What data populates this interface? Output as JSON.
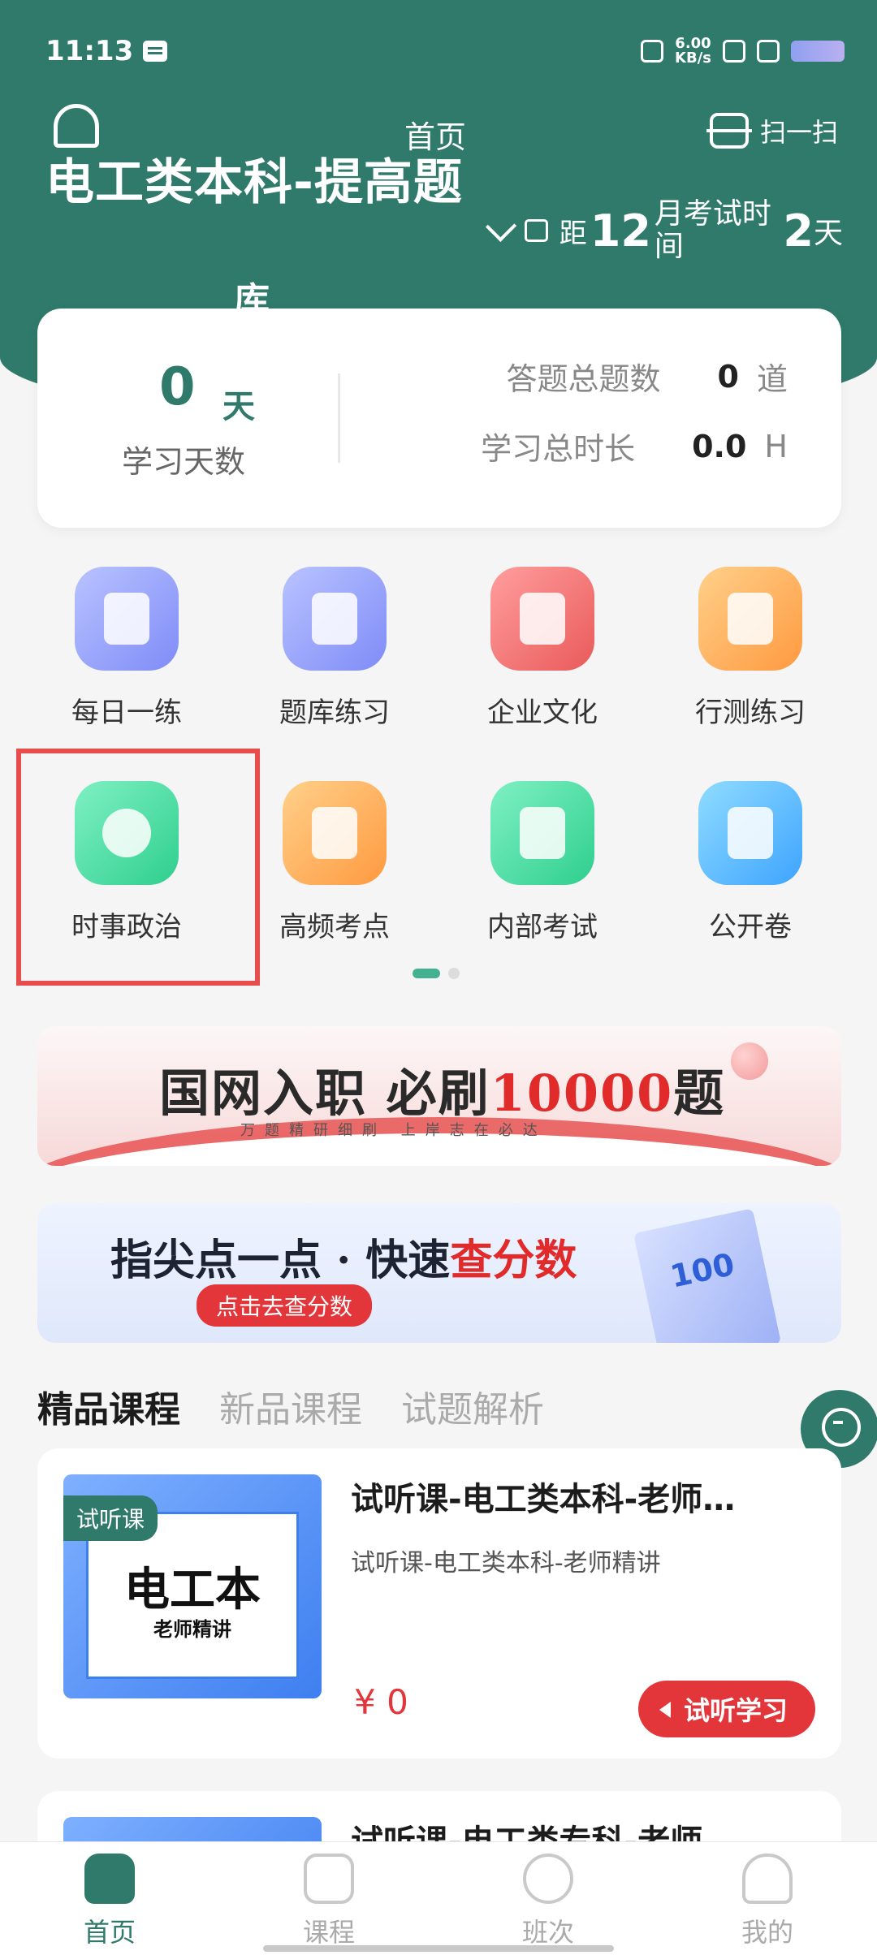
{
  "status_bar": {
    "time": "11:13",
    "net_speed": "6.00",
    "net_unit": "KB/s"
  },
  "header": {
    "page_tab": "首页",
    "title": "电工类本科-提高题",
    "title_wrap": "库",
    "scan_label": "扫一扫",
    "exam_distance_prefix": "距",
    "exam_month_num": "12",
    "exam_month_text": "月考试时间",
    "exam_days_num": "2",
    "exam_days_unit": "天"
  },
  "stats": {
    "study_days_value": "0",
    "study_days_unit": "天",
    "study_days_label": "学习天数",
    "total_questions_label": "答题总题数",
    "total_questions_value": "0",
    "total_questions_unit": "道",
    "total_time_label": "学习总时长",
    "total_time_value": "0.0",
    "total_time_unit": "H"
  },
  "menu": [
    {
      "label": "每日一练",
      "icon": "pencil-note-icon",
      "color": "#8f9bfb"
    },
    {
      "label": "题库练习",
      "icon": "calculator-icon",
      "color": "#8f9bfb"
    },
    {
      "label": "企业文化",
      "icon": "book-icon",
      "color": "#ea5a5a"
    },
    {
      "label": "行测练习",
      "icon": "open-book-icon",
      "color": "#ff9a40"
    },
    {
      "label": "时事政治",
      "icon": "globe-icon",
      "color": "#2fcf8e"
    },
    {
      "label": "高频考点",
      "icon": "receipt-icon",
      "color": "#ff9a40"
    },
    {
      "label": "内部考试",
      "icon": "certificate-icon",
      "color": "#2fcf8e"
    },
    {
      "label": "公开卷",
      "icon": "clipboard-list-icon",
      "color": "#3ea4ff"
    }
  ],
  "banners": {
    "b1_main_a": "国网入职 必刷",
    "b1_main_red": "10000",
    "b1_main_b": "题",
    "b1_sub": "万题精研细刷 上岸志在必达",
    "b2_main_a": "指尖点一点 · 快速",
    "b2_main_red": "查分数",
    "b2_button": "点击去查分数",
    "b2_paper": "100"
  },
  "tabs": [
    "精品课程",
    "新品课程",
    "试题解析"
  ],
  "courses": [
    {
      "tag": "试听课",
      "thumb_title": "电工本",
      "thumb_sub": "老师精讲",
      "title": "试听课-电工类本科-老师…",
      "subtitle": "试听课-电工类本科-老师精讲",
      "price": "¥ 0",
      "button": "试听学习"
    },
    {
      "title": "试听课-电工类专科-老师…"
    }
  ],
  "nav": [
    {
      "label": "首页",
      "icon": "home-icon"
    },
    {
      "label": "课程",
      "icon": "clipboard-icon"
    },
    {
      "label": "班次",
      "icon": "chat-icon"
    },
    {
      "label": "我的",
      "icon": "profile-icon"
    }
  ]
}
